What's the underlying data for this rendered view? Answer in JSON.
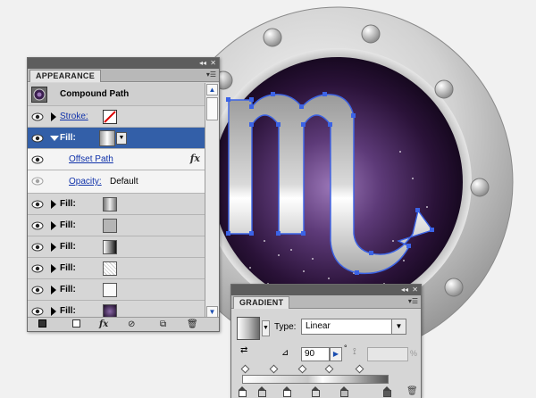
{
  "appearance": {
    "tab_label": "APPEARANCE",
    "header_label": "Compound Path",
    "rows": [
      {
        "type": "stroke",
        "label": "Stroke:"
      },
      {
        "type": "fill_selected",
        "label": "Fill:"
      },
      {
        "type": "sub",
        "label": "Offset Path",
        "fx": "fx"
      },
      {
        "type": "opacity",
        "label": "Opacity:",
        "value": "Default"
      },
      {
        "type": "fill",
        "label": "Fill:"
      },
      {
        "type": "fill",
        "label": "Fill:"
      },
      {
        "type": "fill",
        "label": "Fill:"
      },
      {
        "type": "fill",
        "label": "Fill:"
      },
      {
        "type": "fill",
        "label": "Fill:"
      },
      {
        "type": "fill",
        "label": "Fill:"
      }
    ],
    "bottom_fx": "fx"
  },
  "gradient": {
    "tab_label": "GRADIENT",
    "type_label": "Type:",
    "type_value": "Linear",
    "angle_value": "90",
    "degree_symbol": "°",
    "percent_symbol": "%"
  },
  "colors": {
    "selection": "#335fa8",
    "path_handles": "#3b63e6",
    "orb": "#4a2a5c"
  }
}
